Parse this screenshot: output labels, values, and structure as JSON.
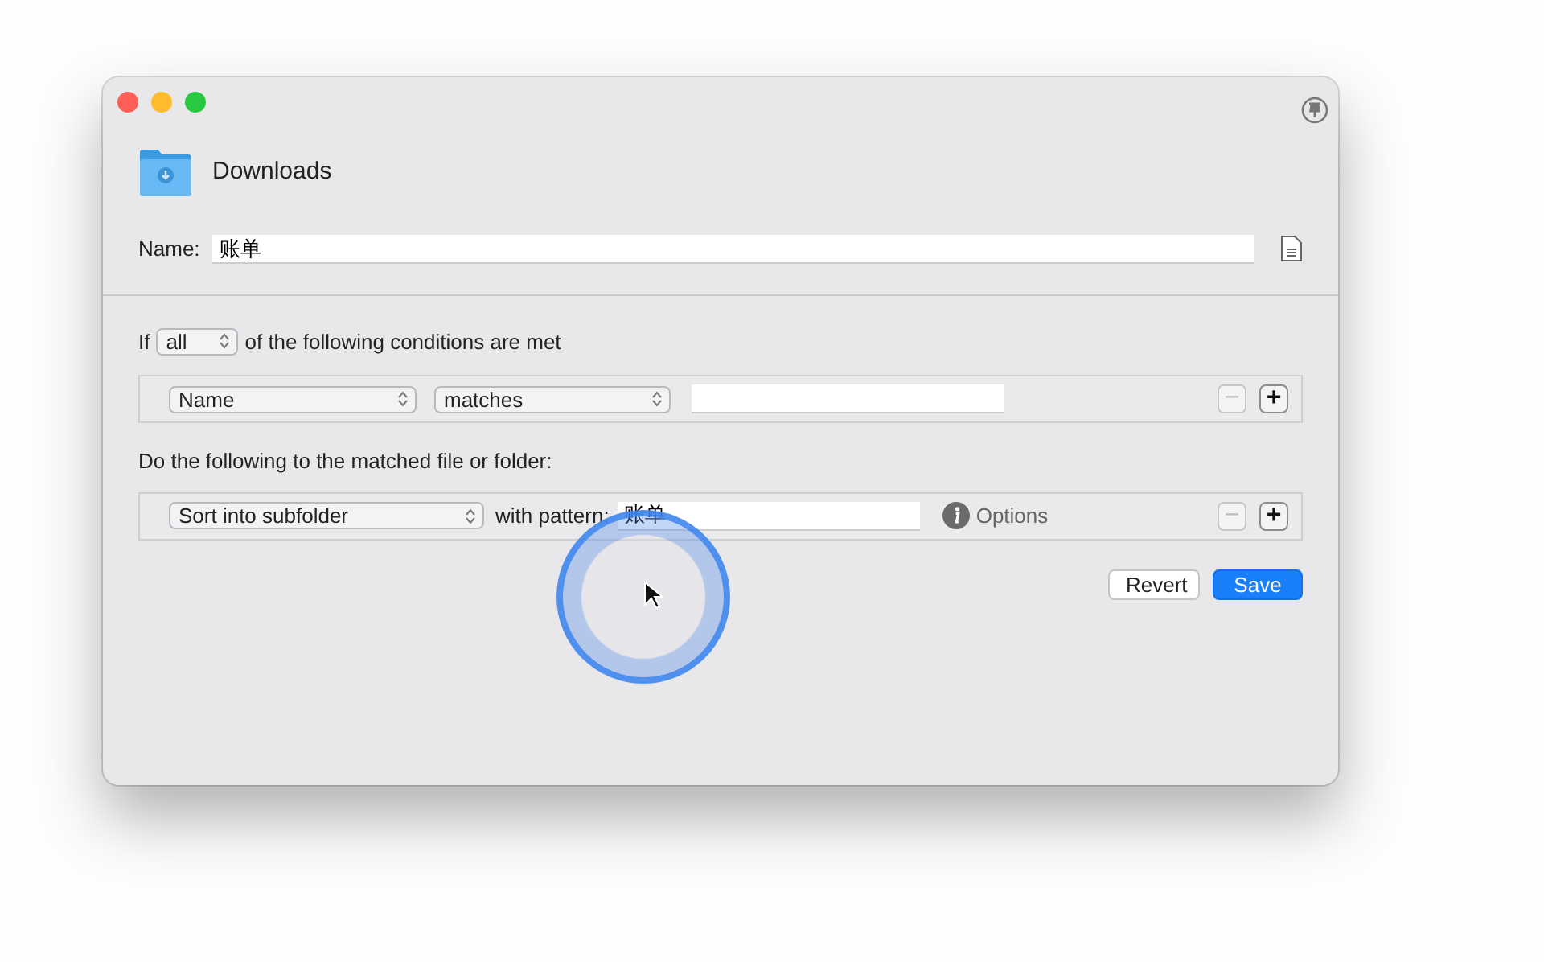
{
  "header": {
    "title": "Downloads"
  },
  "name_field": {
    "label": "Name:",
    "value": "账单"
  },
  "conditions": {
    "prefix": "If",
    "quantifier": "all",
    "suffix": "of the following conditions are met",
    "rows": [
      {
        "attribute": "Name",
        "operator": "matches",
        "remove": {
          "label": "−",
          "disabled": true
        },
        "add": {
          "label": "+",
          "disabled": false
        }
      }
    ]
  },
  "actions": {
    "heading": "Do the following to the matched file or folder:",
    "rows": [
      {
        "action": "Sort into subfolder",
        "pattern_label": "with pattern:",
        "pattern": "账单",
        "options_label": "Options",
        "remove": {
          "label": "−",
          "disabled": true
        },
        "add": {
          "label": "+",
          "disabled": false
        }
      }
    ]
  },
  "buttons": [
    {
      "label": "Revert",
      "kind": "secondary"
    },
    {
      "label": "Save",
      "kind": "primary"
    }
  ]
}
